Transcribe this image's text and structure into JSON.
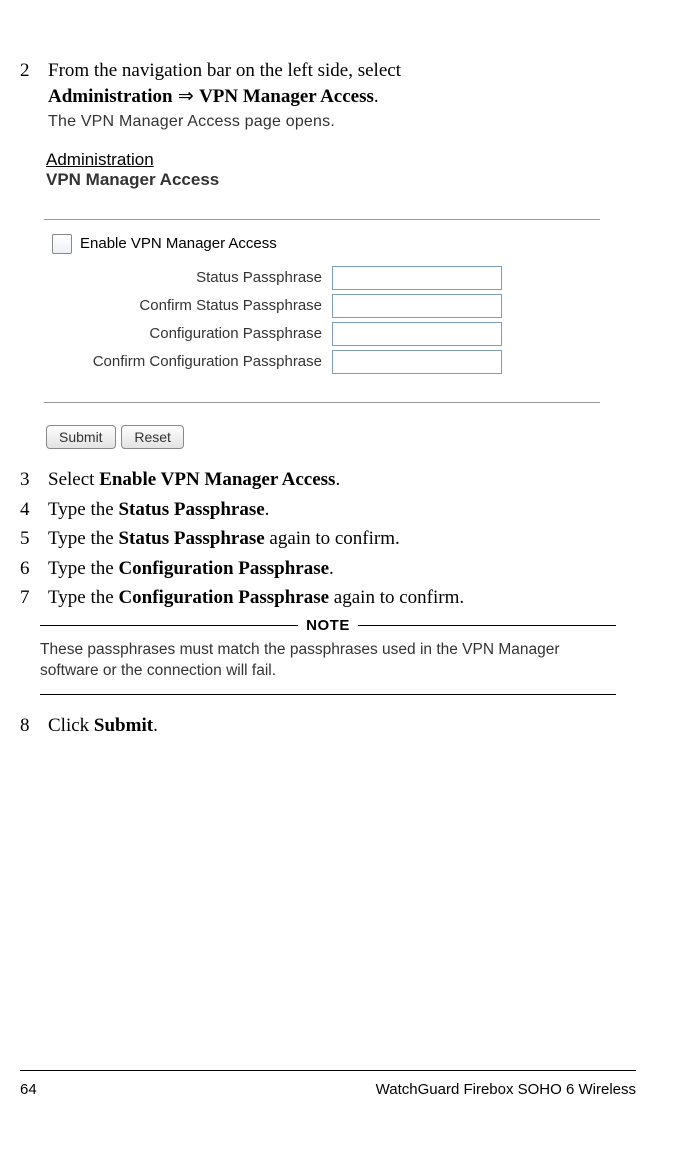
{
  "steps": {
    "s2": {
      "num": "2",
      "pre": "From the navigation bar on the left side, select ",
      "bold1": "Administration",
      "arrow": " ⇒ ",
      "bold2": "VPN Manager Access",
      "post": ".",
      "result": "The VPN Manager Access page opens."
    },
    "s3": {
      "num": "3",
      "pre": "Select ",
      "bold": "Enable VPN Manager Access",
      "post": "."
    },
    "s4": {
      "num": "4",
      "pre": "Type the ",
      "bold": "Status Passphrase",
      "post": "."
    },
    "s5": {
      "num": "5",
      "pre": "Type the ",
      "bold": "Status Passphrase",
      "post": " again to confirm."
    },
    "s6": {
      "num": "6",
      "pre": "Type the ",
      "bold": "Configuration Passphrase",
      "post": "."
    },
    "s7": {
      "num": "7",
      "pre": "Type the ",
      "bold": "Configuration Passphrase",
      "post": " again to confirm."
    },
    "s8": {
      "num": "8",
      "pre": "Click ",
      "bold": "Submit",
      "post": "."
    }
  },
  "screenshot": {
    "breadcrumb": "Administration",
    "title": "VPN Manager Access",
    "checkbox_label": "Enable VPN Manager Access",
    "fields": {
      "f1": "Status Passphrase",
      "f2": "Confirm Status Passphrase",
      "f3": "Configuration Passphrase",
      "f4": "Confirm Configuration Passphrase"
    },
    "buttons": {
      "submit": "Submit",
      "reset": "Reset"
    }
  },
  "note": {
    "label": "NOTE",
    "body": "These passphrases must match the passphrases used in the VPN Manager software or the connection will fail."
  },
  "footer": {
    "page": "64",
    "product": "WatchGuard Firebox SOHO 6 Wireless"
  }
}
